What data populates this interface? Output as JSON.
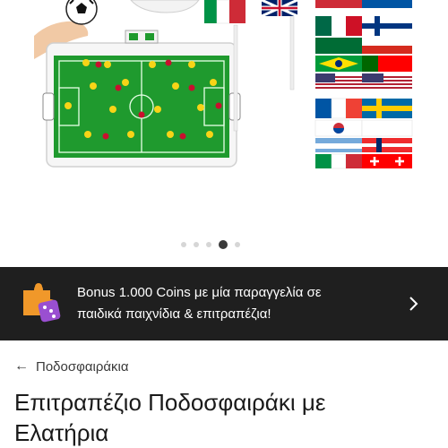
{
  "gallery": {
    "product_image_alt": "Επιτραπέζιο Ποδοσφαιράκι με Ελατήρια",
    "current_image": 4,
    "total_images": 5
  },
  "promo": {
    "line1": "Bonus 1.000 Coins με μία παραγγελία σε",
    "line2": "παιδικά παιχνίδια & επιτραπέζια!",
    "icon": "puzzle-dice-icon",
    "chevron_icon": "chevron-right-icon"
  },
  "breadcrumb": {
    "arrow": "←",
    "label": "Ποδοσφαιράκια"
  },
  "product": {
    "title_line1": "Επιτραπέζιο Ποδοσφαιράκι με",
    "title_line2": "Ελατήρια"
  },
  "colors": {
    "promo_bg": "#1f1f1f",
    "field_green": "#1f9a2e",
    "dot_active": "#3a3a3a",
    "dot_inactive": "#d6d6d6"
  }
}
